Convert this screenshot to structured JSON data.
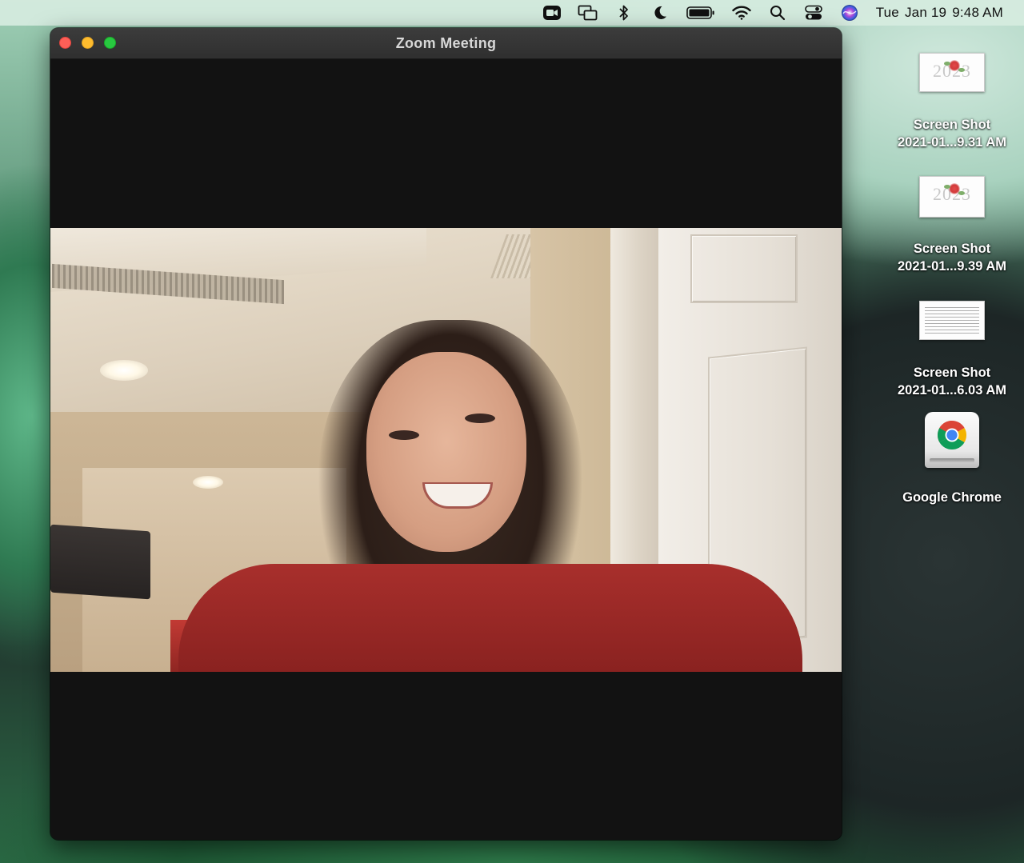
{
  "menubar": {
    "icons": [
      "zoom-icon",
      "screen-mirroring-icon",
      "bluetooth-icon",
      "do-not-disturb-moon-icon",
      "battery-icon",
      "wifi-icon",
      "spotlight-search-icon",
      "control-center-icon",
      "siri-icon"
    ],
    "clock": {
      "day": "Tue",
      "date": "Jan 19",
      "time": "9:48 AM"
    }
  },
  "window": {
    "title": "Zoom Meeting"
  },
  "desktop": {
    "items": [
      {
        "line1": "Screen Shot",
        "line2": "2021-01...9.31 AM",
        "thumb_text": "2023"
      },
      {
        "line1": "Screen Shot",
        "line2": "2021-01...9.39 AM",
        "thumb_text": "2023"
      },
      {
        "line1": "Screen Shot",
        "line2": "2021-01...6.03 AM",
        "thumb_text": ""
      },
      {
        "line1": "Google Chrome",
        "line2": ""
      }
    ]
  },
  "colors": {
    "close": "#fe5f57",
    "minimize": "#febc2e",
    "zoom": "#28c840",
    "window_bg": "#121212"
  }
}
